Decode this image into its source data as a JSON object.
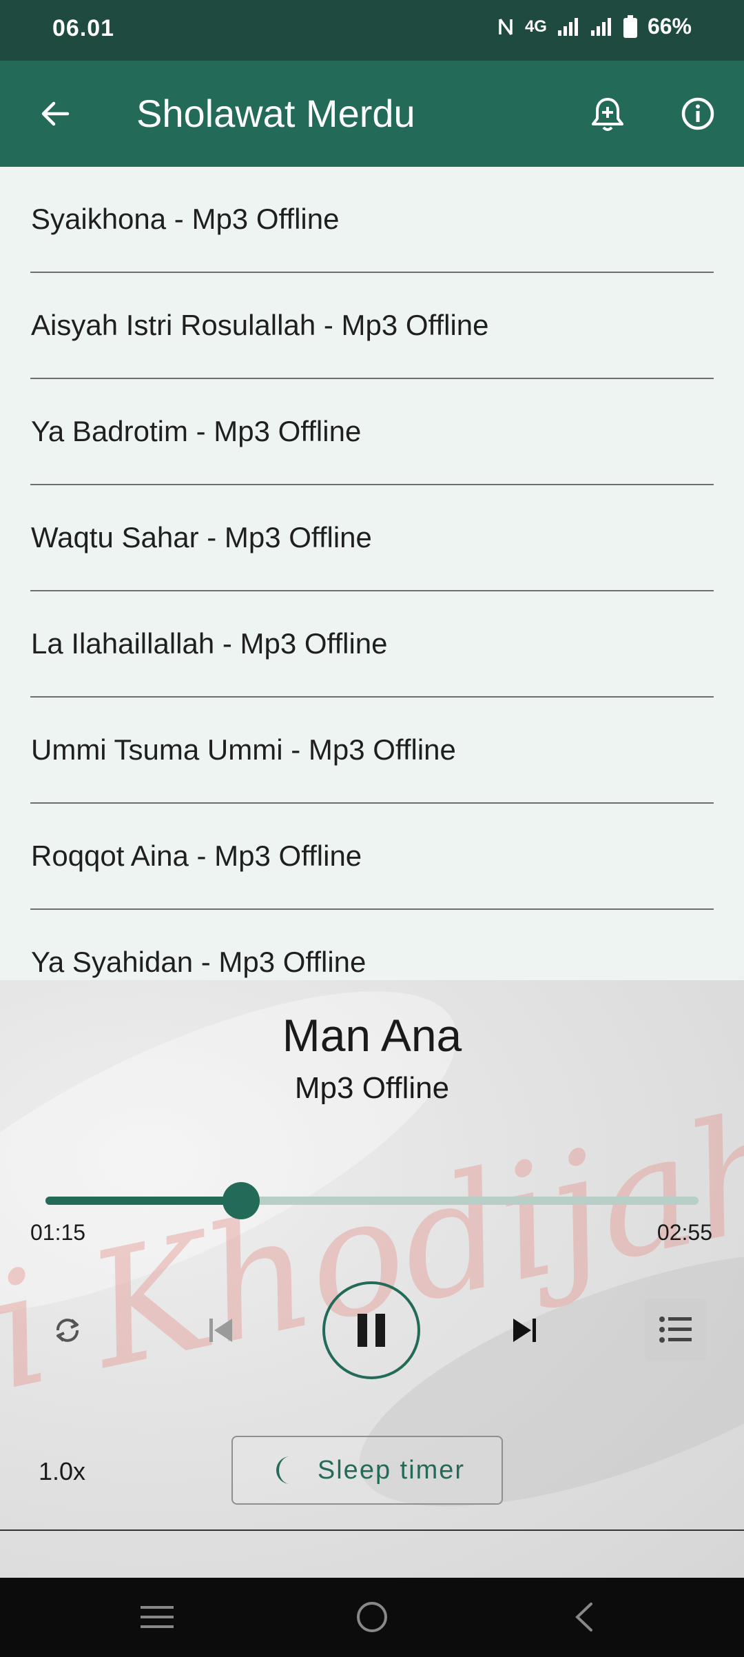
{
  "status_bar": {
    "time": "06.01",
    "network": "4G",
    "battery": "66%"
  },
  "app_bar": {
    "title": "Sholawat Merdu"
  },
  "songs": [
    "Syaikhona - Mp3 Offline",
    "Aisyah Istri Rosulallah - Mp3 Offline",
    "Ya Badrotim - Mp3 Offline",
    "Waqtu Sahar - Mp3 Offline",
    "La Ilahaillallah - Mp3 Offline",
    "Ummi Tsuma Ummi - Mp3 Offline",
    "Roqqot Aina - Mp3 Offline",
    "Ya Syahidan - Mp3 Offline"
  ],
  "player": {
    "title": "Man Ana",
    "subtitle": "Mp3 Offline",
    "current_time": "01:15",
    "total_time": "02:55",
    "progress_fraction": 0.3,
    "speed": "1.0x",
    "sleep_timer_label": "Sleep timer",
    "watermark_text": "i Khodijah"
  },
  "colors": {
    "accent": "#246a58",
    "status_bar": "#1f4a3f",
    "list_bg": "#eef4f2"
  },
  "icons": {
    "back": "arrow-back-icon",
    "bell": "bell-plus-icon",
    "info": "info-icon",
    "repeat": "repeat-icon",
    "prev": "skip-previous-icon",
    "pause": "pause-icon",
    "next": "skip-next-icon",
    "playlist": "playlist-icon",
    "moon": "moon-icon"
  }
}
